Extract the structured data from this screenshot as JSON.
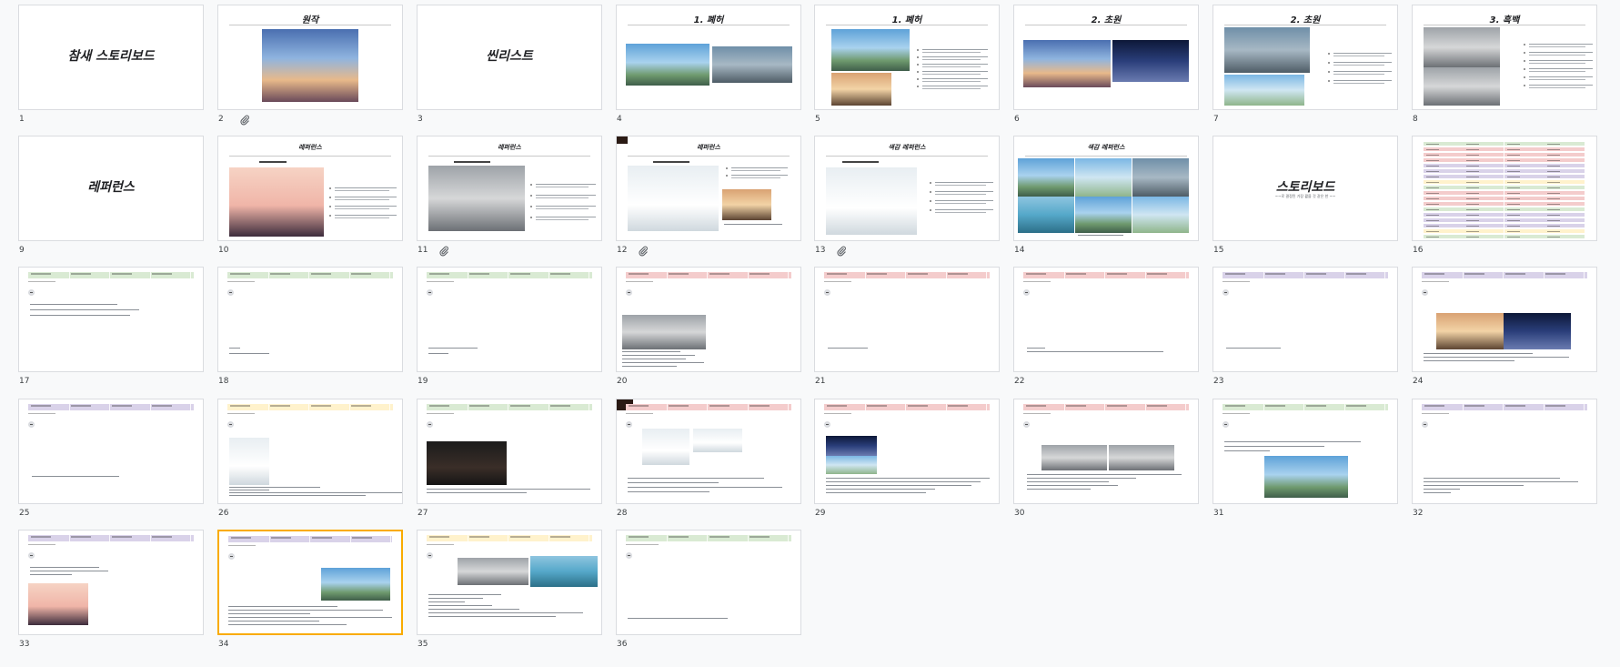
{
  "slides": [
    {
      "number": "1",
      "title": "참새 스토리보드",
      "kind": "title"
    },
    {
      "number": "2",
      "title": "원작",
      "kind": "image",
      "attachment": true
    },
    {
      "number": "3",
      "title": "씬리스트",
      "kind": "title"
    },
    {
      "number": "4",
      "title": "1. 폐허",
      "kind": "image"
    },
    {
      "number": "5",
      "title": "1. 폐허",
      "kind": "image"
    },
    {
      "number": "6",
      "title": "2. 초원",
      "kind": "image"
    },
    {
      "number": "7",
      "title": "2. 초원",
      "kind": "image"
    },
    {
      "number": "8",
      "title": "3. 흑백",
      "kind": "image"
    },
    {
      "number": "9",
      "title": "레퍼런스",
      "kind": "title"
    },
    {
      "number": "10",
      "title": "레퍼런스",
      "kind": "image"
    },
    {
      "number": "11",
      "title": "레퍼런스",
      "kind": "image",
      "attachment": true
    },
    {
      "number": "12",
      "title": "레퍼런스",
      "kind": "image",
      "attachment": true
    },
    {
      "number": "13",
      "title": "색감 레퍼런스",
      "kind": "image",
      "attachment": true
    },
    {
      "number": "14",
      "title": "색감 레퍼런스",
      "kind": "image"
    },
    {
      "number": "15",
      "title": "스토리보드",
      "kind": "title"
    },
    {
      "number": "16",
      "title": "",
      "kind": "table"
    },
    {
      "number": "17",
      "title": "",
      "kind": "storyboard",
      "bar": "green"
    },
    {
      "number": "18",
      "title": "",
      "kind": "storyboard",
      "bar": "green"
    },
    {
      "number": "19",
      "title": "",
      "kind": "storyboard",
      "bar": "green"
    },
    {
      "number": "20",
      "title": "",
      "kind": "storyboard",
      "bar": "red"
    },
    {
      "number": "21",
      "title": "",
      "kind": "storyboard",
      "bar": "red"
    },
    {
      "number": "22",
      "title": "",
      "kind": "storyboard",
      "bar": "red"
    },
    {
      "number": "23",
      "title": "",
      "kind": "storyboard",
      "bar": "purple"
    },
    {
      "number": "24",
      "title": "",
      "kind": "storyboard",
      "bar": "purple"
    },
    {
      "number": "25",
      "title": "",
      "kind": "storyboard",
      "bar": "purple"
    },
    {
      "number": "26",
      "title": "",
      "kind": "storyboard",
      "bar": "yellow"
    },
    {
      "number": "27",
      "title": "",
      "kind": "storyboard",
      "bar": "green"
    },
    {
      "number": "28",
      "title": "",
      "kind": "storyboard",
      "bar": "red"
    },
    {
      "number": "29",
      "title": "",
      "kind": "storyboard",
      "bar": "red"
    },
    {
      "number": "30",
      "title": "",
      "kind": "storyboard",
      "bar": "red"
    },
    {
      "number": "31",
      "title": "",
      "kind": "storyboard",
      "bar": "green"
    },
    {
      "number": "32",
      "title": "",
      "kind": "storyboard",
      "bar": "purple"
    },
    {
      "number": "33",
      "title": "",
      "kind": "storyboard",
      "bar": "purple"
    },
    {
      "number": "34",
      "title": "",
      "kind": "storyboard",
      "bar": "purple",
      "selected": true
    },
    {
      "number": "35",
      "title": "",
      "kind": "storyboard",
      "bar": "yellow"
    },
    {
      "number": "36",
      "title": "",
      "kind": "storyboard",
      "bar": "green"
    }
  ],
  "slide_subtitles": {
    "15": "~~로 결정된 가장 짧을 것 같은 한 ~~"
  },
  "colors": {
    "background": "#f8f9fa",
    "selected_border": "#f9ab00",
    "bar_green": "#d9ead3",
    "bar_red": "#f4cccc",
    "bar_purple": "#d9d2e9",
    "bar_yellow": "#fff2cc"
  },
  "icons": {
    "attachment": "attachment-clip-icon"
  }
}
